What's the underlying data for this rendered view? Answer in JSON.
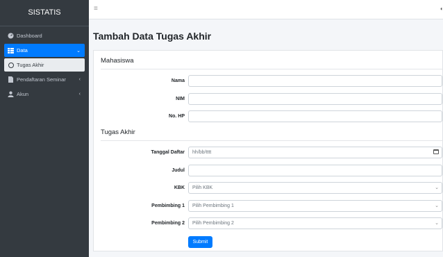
{
  "brand": "SISTATIS",
  "sidebar": {
    "items": [
      {
        "label": "Dashboard"
      },
      {
        "label": "Data"
      },
      {
        "label": "Tugas Akhir"
      },
      {
        "label": "Pendaftaran Seminar"
      },
      {
        "label": "Akun"
      }
    ]
  },
  "page": {
    "title": "Tambah Data Tugas Akhir",
    "mahasiswa": {
      "title": "Mahasiswa",
      "nama": "Nama",
      "nim": "NIM",
      "nohp": "No. HP"
    },
    "tugas_akhir": {
      "title": "Tugas Akhir",
      "tanggal_label": "Tanggal Daftar",
      "tanggal_placeholder": "hh/bb/tttt",
      "judul": "Judul",
      "kbk_label": "KBK",
      "kbk_value": "Pilih KBK",
      "p1_label": "Pembimbing 1",
      "p1_value": "Pilih Pembimbing 1",
      "p2_label": "Pembimbing 2",
      "p2_value": "Pilih Pembimbing 2"
    },
    "submit": "Submit"
  },
  "colors": {
    "sidebar": "#343a40",
    "primary": "#007bff"
  }
}
